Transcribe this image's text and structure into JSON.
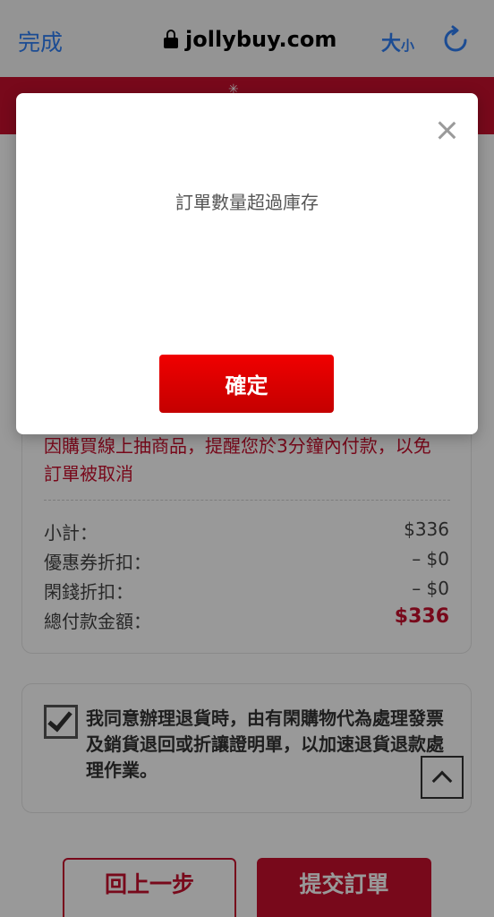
{
  "browser": {
    "done_label": "完成",
    "url": "jollybuy.com",
    "textsize_big": "大",
    "textsize_small": "小"
  },
  "order_summary": {
    "warning": "因購買線上抽商品，提醒您於3分鐘內付款，以免訂單被取消",
    "subtotal_label": "小計：",
    "subtotal_value": "$336",
    "coupon_label": "優惠券折扣：",
    "coupon_value": "– $0",
    "cash_label": "閑錢折扣：",
    "cash_value": "– $0",
    "total_label": "總付款金額：",
    "total_value": "$336"
  },
  "agreement": {
    "checked": true,
    "text": "我同意辦理退貨時，由有閑購物代為處理發票及銷貨退回或折讓證明單，以加速退貨退款處理作業。"
  },
  "buttons": {
    "back": "回上一步",
    "submit": "提交訂單"
  },
  "modal": {
    "message": "訂單數量超過庫存",
    "confirm": "確定"
  },
  "colors": {
    "brand_red": "#c8102e",
    "ios_blue": "#2f7ff5"
  }
}
